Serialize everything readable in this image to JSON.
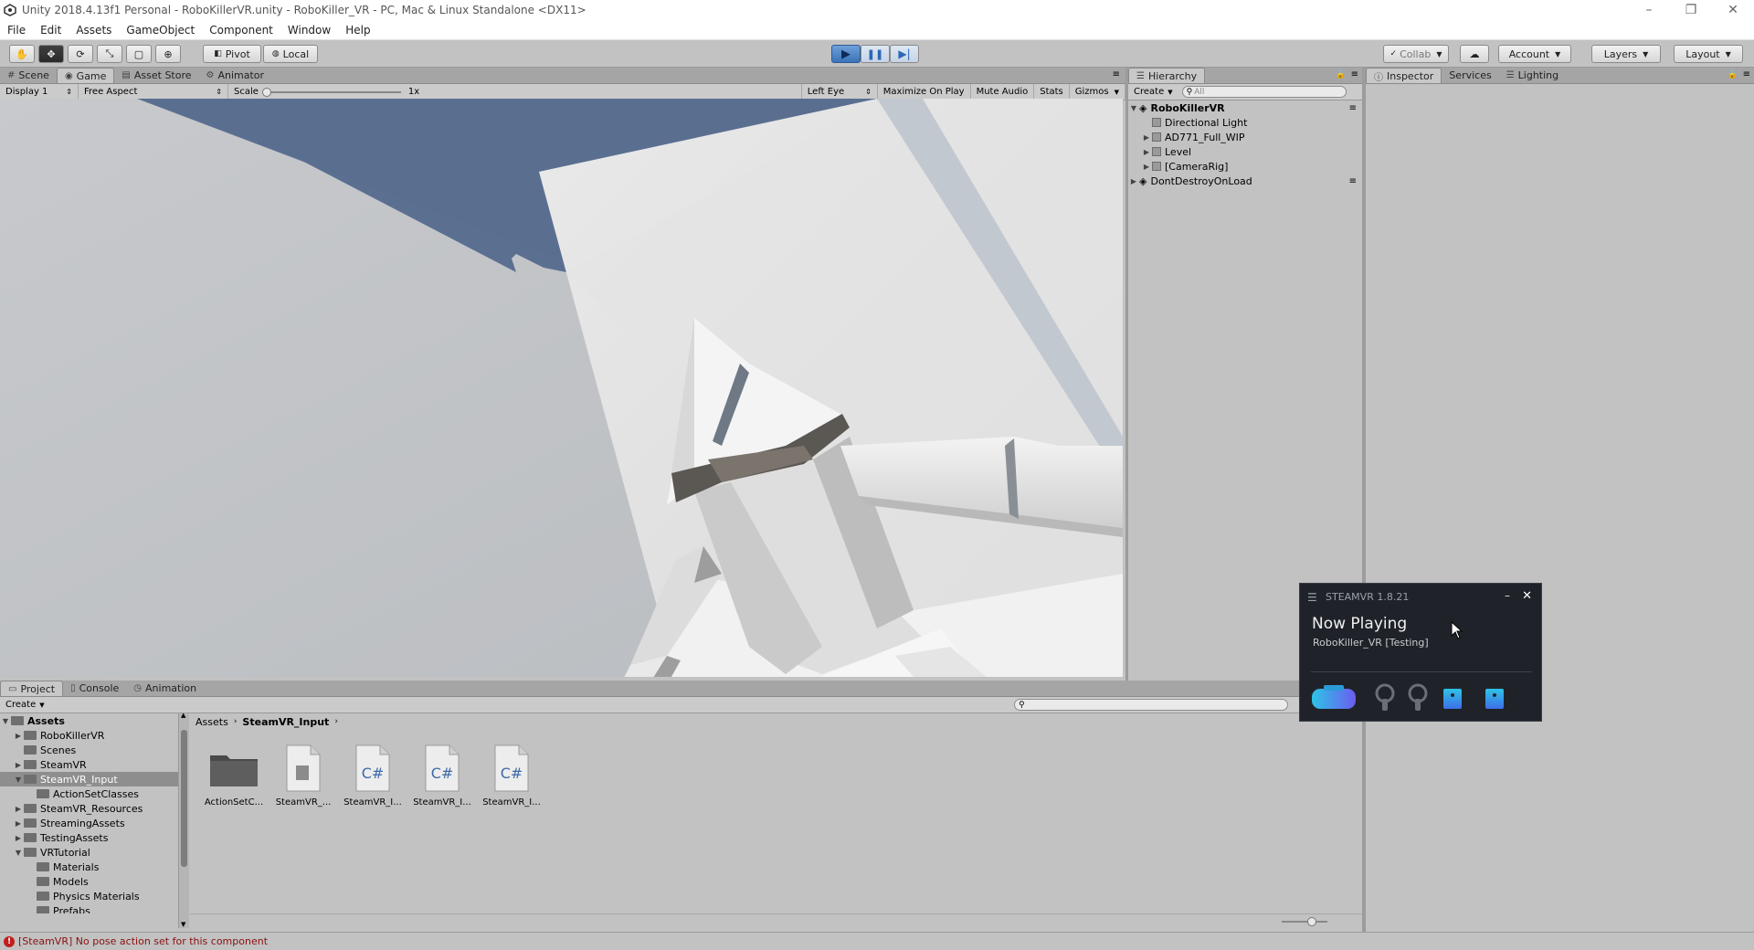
{
  "window": {
    "title": "Unity 2018.4.13f1 Personal - RoboKillerVR.unity - RoboKiller_VR - PC, Mac & Linux Standalone <DX11>",
    "controls": [
      "–",
      "❐",
      "✕"
    ]
  },
  "menu": [
    "File",
    "Edit",
    "Assets",
    "GameObject",
    "Component",
    "Window",
    "Help"
  ],
  "toolbar": {
    "pivot": "Pivot",
    "local": "Local",
    "collab": "Collab",
    "account": "Account",
    "layers": "Layers",
    "layout": "Layout"
  },
  "viewTabs": [
    "Scene",
    "Game",
    "Asset Store",
    "Animator"
  ],
  "gameBar": {
    "display": "Display 1",
    "aspect": "Free Aspect",
    "scaleLabel": "Scale",
    "scaleValue": "1x",
    "eye": "Left Eye",
    "maximize": "Maximize On Play",
    "mute": "Mute Audio",
    "stats": "Stats",
    "gizmos": "Gizmos"
  },
  "hierarchy": {
    "tab": "Hierarchy",
    "create": "Create",
    "searchPlaceholder": "All",
    "scene": "RoboKillerVR",
    "items": [
      "Directional Light",
      "AD771_Full_WIP",
      "Level",
      "[CameraRig]"
    ],
    "dontDestroy": "DontDestroyOnLoad"
  },
  "inspectorTabs": [
    "Inspector",
    "Services",
    "Lighting"
  ],
  "projectTabs": [
    "Project",
    "Console",
    "Animation"
  ],
  "project": {
    "create": "Create",
    "breadcrumb": [
      "Assets",
      "SteamVR_Input"
    ],
    "tree": [
      {
        "label": "Assets",
        "depth": 0,
        "open": true,
        "bold": true
      },
      {
        "label": "RoboKillerVR",
        "depth": 1,
        "arrow": true
      },
      {
        "label": "Scenes",
        "depth": 1
      },
      {
        "label": "SteamVR",
        "depth": 1,
        "arrow": true
      },
      {
        "label": "SteamVR_Input",
        "depth": 1,
        "open": true,
        "selected": true
      },
      {
        "label": "ActionSetClasses",
        "depth": 2
      },
      {
        "label": "SteamVR_Resources",
        "depth": 1,
        "arrow": true
      },
      {
        "label": "StreamingAssets",
        "depth": 1,
        "arrow": true
      },
      {
        "label": "TestingAssets",
        "depth": 1,
        "arrow": true
      },
      {
        "label": "VRTutorial",
        "depth": 1,
        "open": true
      },
      {
        "label": "Materials",
        "depth": 2
      },
      {
        "label": "Models",
        "depth": 2
      },
      {
        "label": "Physics Materials",
        "depth": 2
      },
      {
        "label": "Prefabs",
        "depth": 2
      }
    ],
    "assets": [
      "ActionSetC...",
      "SteamVR_...",
      "SteamVR_I...",
      "SteamVR_I...",
      "SteamVR_I..."
    ]
  },
  "status": {
    "message": "[SteamVR] No pose action set for this component"
  },
  "steamvr": {
    "title": "STEAMVR 1.8.21",
    "heading": "Now Playing",
    "app": "RoboKiller_VR [Testing]"
  }
}
